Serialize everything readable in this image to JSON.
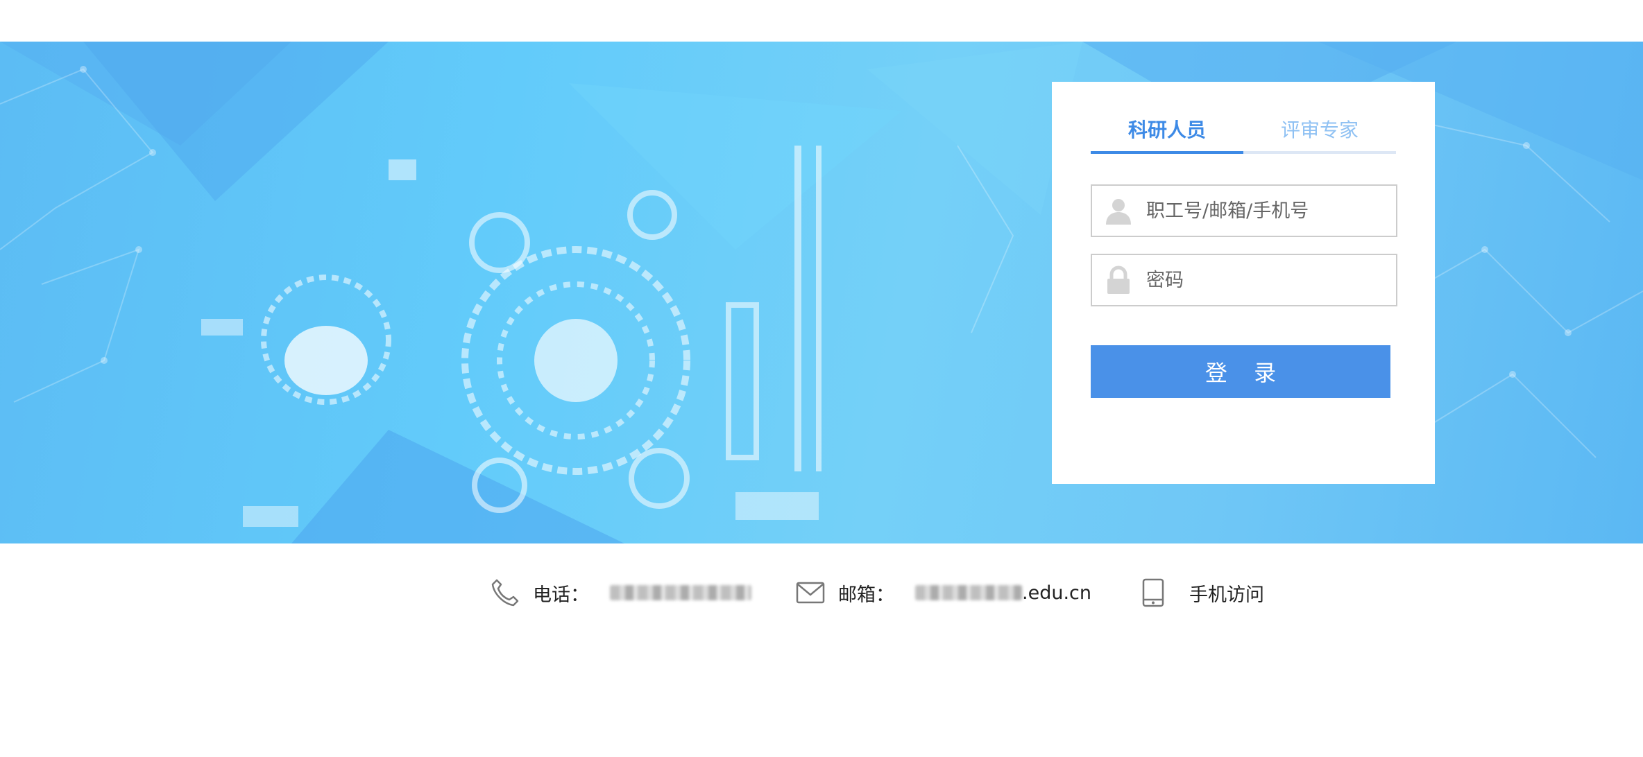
{
  "login": {
    "tabs": [
      {
        "label": "科研人员",
        "active": true
      },
      {
        "label": "评审专家",
        "active": false
      }
    ],
    "username_placeholder": "职工号/邮箱/手机号",
    "password_placeholder": "密码",
    "submit_label": "登 录"
  },
  "footer": {
    "phone_label": "电话：",
    "email_label": "邮箱：",
    "email_suffix": ".edu.cn",
    "mobile_label": "手机访问"
  },
  "colors": {
    "accent": "#4a91e8",
    "active_tab": "#3d8ae6",
    "inactive_tab": "#8fc1f3",
    "banner": "#62cbfa"
  },
  "icons": {
    "user": "user-icon",
    "lock": "lock-icon",
    "phone": "phone-icon",
    "mail": "mail-icon",
    "mobile": "mobile-icon"
  }
}
